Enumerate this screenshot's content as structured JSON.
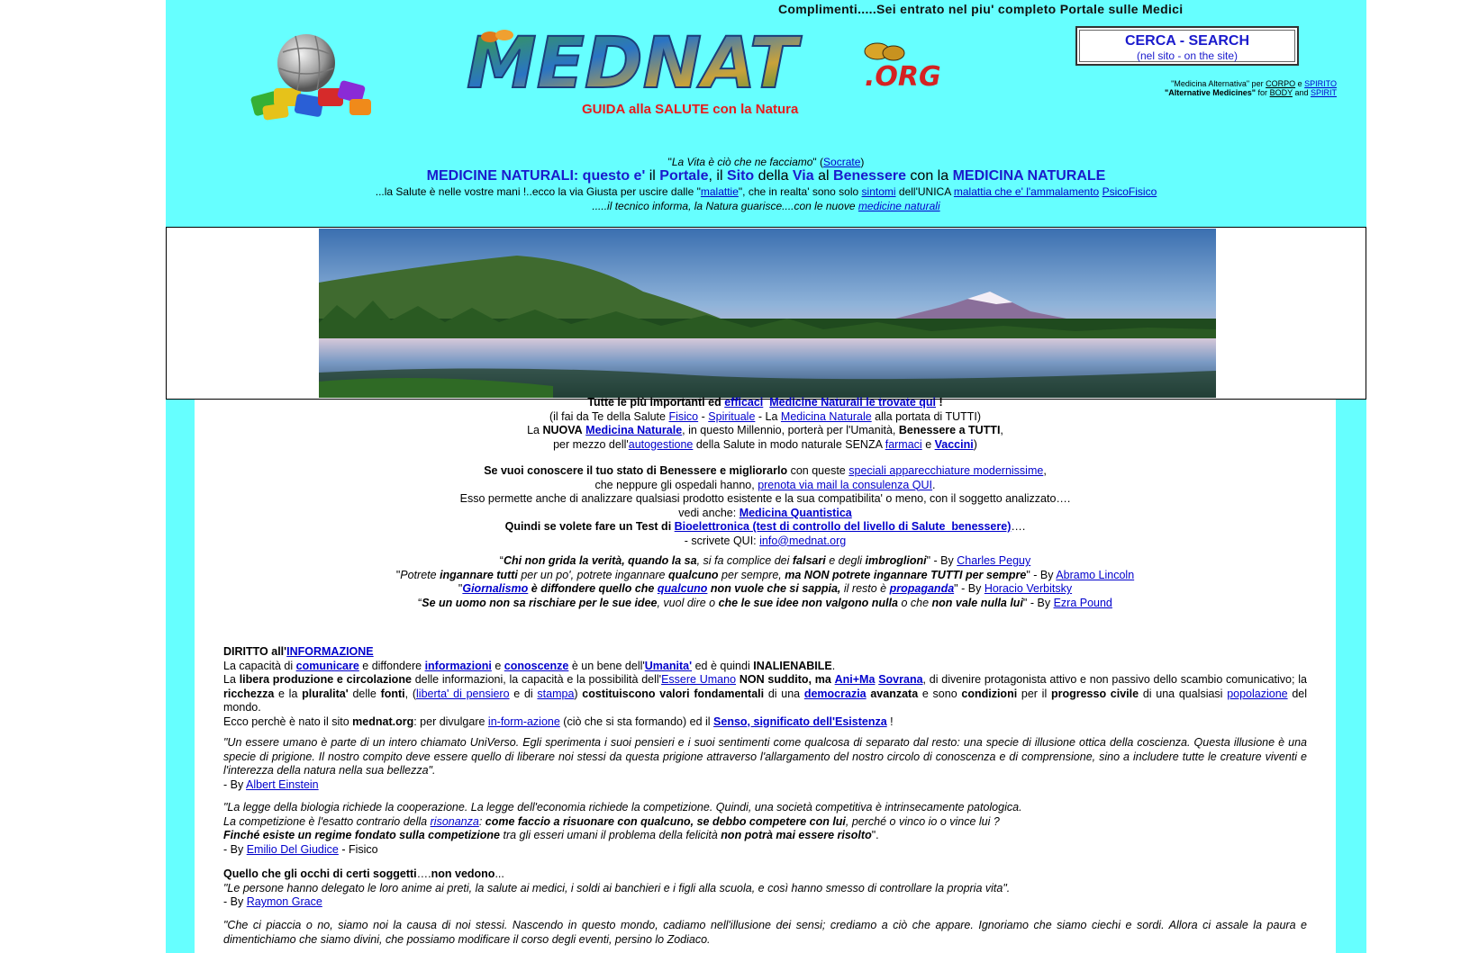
{
  "header": {
    "topline": "Complimenti.....Sei entrato nel piu' completo Portale sulle Medici",
    "logo_text": "MEDNAT",
    "logo_suffix": ".ORG",
    "tagline": "GUIDA  alla  SALUTE con la Natura",
    "search_title": "CERCA  -  SEARCH",
    "search_sub": "(nel sito - on the site)",
    "alt_it": "\"Medicina Alternativa\"  per",
    "alt_it_corpo": "CORPO",
    "alt_it_e": "e",
    "alt_it_spirito": "SPIRITO",
    "alt_en": "\"Alternative Medicines\"",
    "alt_en_for": "for",
    "alt_en_body": "BODY",
    "alt_en_and": "and",
    "alt_en_spirit": "SPIRIT"
  },
  "intro": {
    "quote_text": "La Vita è ciò che ne facciamo",
    "quote_author": "Socrate",
    "title_a": "MEDICINE NATURALI: questo e'",
    "title_b": "il",
    "title_c": "Portale",
    "title_d": ", il",
    "title_e": "Sito",
    "title_f": "della",
    "title_g": "Via",
    "title_h": "al",
    "title_i": "Benessere",
    "title_j": "con la",
    "title_k": "MEDICINA NATURALE",
    "l3a": "...la Salute è nelle vostre mani !..ecco la via Giusta per uscire dalle \"",
    "l3_link1": "malattie",
    "l3b": "\", che in realta' sono solo",
    "l3_link2": "sintomi",
    "l3c": "dell'UNICA",
    "l3_link3": "malattia che e' l'ammalamento",
    "l3_link4": "PsicoFisico",
    "l4a": ".....il tecnico informa, la Natura guarisce....con le nuove",
    "l4_link": "medicine naturali"
  },
  "body": {
    "b1": "Tutte le più importanti ed",
    "b1_link1": "efficaci",
    "b1_link2": "Medicine Naturali  le trovate qui",
    "b1_end": "!",
    "b2a": "(il fai da Te della Salute",
    "b2_link1": "Fisico",
    "b2b": "-",
    "b2_link2": "Spirituale",
    "b2c": "- La",
    "b2_link3": "Medicina Naturale",
    "b2d": "alla portata di TUTTI)",
    "b3a": "La",
    "b3_bold1": "NUOVA",
    "b3_link": "Medicina Naturale",
    "b3b": ", in questo Millennio, porterà per l'Umanità,",
    "b3_bold2": "Benessere a TUTTI",
    "b3c": ",",
    "b4a": "per mezzo dell'",
    "b4_link1": "autogestione",
    "b4b": "della Salute in modo naturale SENZA",
    "b4_link2": "farmaci",
    "b4c": "e",
    "b4_link3": "Vaccini",
    "b4d": ")",
    "s1_bold": "Se vuoi conoscere il tuo stato di Benessere e migliorarlo",
    "s1a": "con queste",
    "s1_link": "speciali apparecchiature modernissime",
    "s1b": ",",
    "s2a": "che neppure gli ospedali hanno,",
    "s2_link": "prenota via mail la consulenza QUI",
    "s2b": ".",
    "s3": "Esso permette anche di analizzare qualsiasi prodotto esistente e la sua compatibilita' o meno, con il soggetto analizzato….",
    "s4a": "vedi anche:",
    "s4_link": "Medicina Quantistica",
    "s5a": "Quindi se volete fare un Test di",
    "s5_link": "Bioelettronica (test di controllo del livello di Salute_benessere)",
    "s5b": "….",
    "s6a": "- scrivete QUI:",
    "s6_link": "info@mednat.org",
    "q1a": "Chi non grida la verità, quando la sa",
    "q1b": ", si fa complice dei",
    "q1c": "falsari",
    "q1d": "e degli",
    "q1e": "imbroglioni",
    "q1f": "- By",
    "q1_author": "Charles Peguy",
    "q2a": "Potrete",
    "q2b": "ingannare tutti",
    "q2c": "per un po', potrete ingannare",
    "q2d": "qualcuno",
    "q2e": "per sempre,",
    "q2f": "ma NON potrete ingannare TUTTI per sempre",
    "q2g": "- By",
    "q2_author": "Abramo Lincoln",
    "q3_link1": "Giornalismo",
    "q3a": "è diffondere quello che",
    "q3_link2": "qualcuno",
    "q3b": "non vuole che si sappia,",
    "q3c": "il resto è",
    "q3_link3": "propaganda",
    "q3d": "- By",
    "q3_author": "Horacio Verbitsky",
    "q4a": "Se un uomo non sa rischiare per le sue idee",
    "q4b": ", vuol dire o",
    "q4c": "che le sue idee non valgono nulla",
    "q4d": "o che",
    "q4e": "non vale nulla lui",
    "q4f": "- By",
    "q4_author": "Ezra Pound",
    "d_title": "DIRITTO all'",
    "d_title_link": "INFORMAZIONE",
    "d1a": "La capacità di",
    "d1_link1": "comunicare",
    "d1b": "e diffondere",
    "d1_link2": "informazioni",
    "d1c": "e",
    "d1_link3": "conoscenze",
    "d1d": "è un bene dell'",
    "d1_link4": "Umanita'",
    "d1e": "ed è quindi",
    "d1f": "INALIENABILE",
    "d1g": ".",
    "d2a": "La",
    "d2b": "libera produzione e circolazione",
    "d2c": "delle informazioni, la capacità e  la possibilità dell'",
    "d2_link1": "Essere Umano",
    "d2d": "NON suddito, ma",
    "d2_link2": "Ani+Ma",
    "d2_link3": "Sovrana",
    "d2e": ", di divenire protagonista attivo e non passivo dello scambio comunicativo;  la",
    "d2f": "ricchezza",
    "d2g": "e la",
    "d2h": "pluralita'",
    "d2i": "delle",
    "d2j": "fonti",
    "d2k": ", (",
    "d2_link4": "liberta' di pensiero",
    "d2l": "e di",
    "d2_link5": "stampa",
    "d2m": ")",
    "d2n": "costituiscono valori fondamentali",
    "d2o": "di una",
    "d2_link6": "democrazia",
    "d2p": "avanzata",
    "d2q": "e sono",
    "d2r": "condizioni",
    "d2s": "per il",
    "d2t": "progresso civile",
    "d2u": "di una qualsiasi",
    "d2_link7": "popolazione",
    "d2v": "del mondo.",
    "d3a": "Ecco perchè è nato il sito",
    "d3b": "mednat.org",
    "d3c": ": per divulgare",
    "d3_link1": "in-form-azione",
    "d3d": "(ciò che si sta formando) ed il",
    "d3_link2": "Senso, significato dell'Esistenza",
    "d3e": "!",
    "e1": "\"Un essere umano è parte di un intero chiamato UniVerso. Egli sperimenta i suoi pensieri e i suoi sentimenti come qualcosa di separato dal resto: una specie di illusione ottica della coscienza. Questa illusione è una specie di prigione. Il nostro compito deve essere quello di liberare noi stessi da questa prigione attraverso l'allargamento del nostro circolo di conoscenza e di comprensione, sino a includere tutte le creature viventi e l'interezza della natura nella sua bellezza\".",
    "e_by": "- By",
    "e_author": "Albert Einstein",
    "g1": "\"La legge della biologia richiede la cooperazione. La legge dell'economia richiede la competizione. Quindi, una società competitiva è intrinsecamente patologica.",
    "g2a": "La competizione è l'esatto contrario della",
    "g2_link": "risonanza",
    "g2b": ":",
    "g2c": "come faccio a risuonare con qualcuno, se debbo competere con lui",
    "g2d": ", perché o vinco io o vince lui ?",
    "g3a": "Finché esiste un regime fondato sulla competizione",
    "g3b": "tra gli esseri umani il problema della felicità",
    "g3c": "non potrà mai essere risolto",
    "g3d": "\".",
    "g_by": "- By",
    "g_author": "Emilio Del Giudice",
    "g_role": "-  Fisico",
    "r_title_a": "Quello che gli occhi di certi soggetti",
    "r_title_b": "….",
    "r_title_c": "non vedono",
    "r_title_d": "...",
    "r1": "\"Le persone hanno delegato le loro anime ai preti, la salute ai medici, i soldi ai banchieri e i figli alla scuola, e così hanno smesso di controllare la propria vita\".",
    "r_by": "- By",
    "r_author": "Raymon Grace",
    "z1": "\"Che ci piaccia o no, siamo noi la causa di noi stessi. Nascendo in questo mondo, cadiamo nell'illusione dei sensi; crediamo a ciò che appare. Ignoriamo che siamo ciechi e sordi. Allora ci assale la paura e dimentichiamo che siamo divini, che possiamo modificare il corso degli eventi, persino lo Zodiaco."
  }
}
